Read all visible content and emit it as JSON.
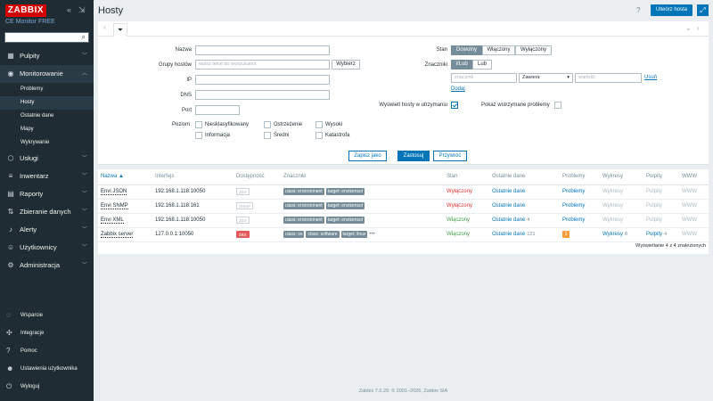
{
  "sidebar": {
    "logo": "ZABBIX",
    "edition": "CE Monitor FREE",
    "search_placeholder": "",
    "menu": [
      {
        "label": "Pulpity",
        "icon": "dashboard-icon"
      },
      {
        "label": "Monitorowanie",
        "icon": "eye-icon",
        "open": true,
        "children": [
          "Problemy",
          "Hosty",
          "Ostatnie dane",
          "Mapy",
          "Wykrywanie"
        ]
      },
      {
        "label": "Usługi",
        "icon": "services-icon"
      },
      {
        "label": "Inwentarz",
        "icon": "inventory-icon"
      },
      {
        "label": "Raporty",
        "icon": "reports-icon"
      },
      {
        "label": "Zbieranie danych",
        "icon": "data-collection-icon"
      },
      {
        "label": "Alerty",
        "icon": "bell-icon"
      },
      {
        "label": "Użytkownicy",
        "icon": "users-icon"
      },
      {
        "label": "Administracja",
        "icon": "gear-icon"
      }
    ],
    "bottom": [
      {
        "label": "Wsparcie",
        "icon": "support-icon"
      },
      {
        "label": "Integracje",
        "icon": "integrations-icon"
      },
      {
        "label": "Pomoc",
        "icon": "help-icon"
      },
      {
        "label": "Ustawienia użytkownika",
        "icon": "user-settings-icon"
      },
      {
        "label": "Wyloguj",
        "icon": "power-icon"
      }
    ]
  },
  "header": {
    "title": "Hosty",
    "help": "?",
    "create_host": "Utwórz hosta"
  },
  "filter": {
    "name_label": "Nazwa",
    "groups_label": "Grupy hostów",
    "groups_placeholder": "wpisz tekst do wyszukania",
    "select_button": "Wybierz",
    "ip_label": "IP",
    "dns_label": "DNS",
    "port_label": "Port",
    "severity_label": "Poziom",
    "severities": [
      "Niesklasyfikowany",
      "Informacja",
      "Ostrzeżenie",
      "Średni",
      "Wysoki",
      "Katastrofa"
    ],
    "status_label": "Stan",
    "status_options": [
      "Dowolny",
      "Włączony",
      "Wyłączony"
    ],
    "tags_label": "Znaczniki",
    "tag_mode_options": [
      "I/Lub",
      "Lub"
    ],
    "tag_placeholder": "znacznik",
    "tag_operator": "Zawiera",
    "tag_value_placeholder": "wartość",
    "remove_link": "Usuń",
    "add_link": "Dodaj",
    "show_maintenance_label": "Wyświetl hosty w utrzymaniu",
    "show_suppressed_label": "Pokaż wstrzymane problemy",
    "save_as": "Zapisz jako",
    "apply": "Zastosuj",
    "reset": "Przywróć"
  },
  "table": {
    "headers": [
      "Nazwa ▲",
      "Interfejs",
      "Dostępność",
      "Znaczniki",
      "Stan",
      "Ostatnie dane",
      "Problemy",
      "Wykresy",
      "Pulpity",
      "WWW"
    ],
    "rows": [
      {
        "name": "Envi JSON",
        "iface": "192.168.1.118:10050",
        "avail": "ZBX",
        "avail_red": false,
        "tags": [
          "class: environment",
          "target: envisensor"
        ],
        "more": "",
        "status": "Wyłączony",
        "status_class": "st-red",
        "latest": "Ostatnie dane",
        "latest_count": "",
        "problems": "Problemy",
        "problem_badge": "",
        "graphs": "Wykresy",
        "graphs_count": "",
        "graphs_link": false,
        "dash": "Pulpity",
        "dash_count": "",
        "dash_link": false,
        "web": "WWW"
      },
      {
        "name": "Envi SNMP",
        "iface": "192.168.1.118:161",
        "avail": "SNMP",
        "avail_red": false,
        "tags": [
          "class: environment",
          "target: envisensor"
        ],
        "more": "",
        "status": "Wyłączony",
        "status_class": "st-red",
        "latest": "Ostatnie dane",
        "latest_count": "",
        "problems": "Problemy",
        "problem_badge": "",
        "graphs": "Wykresy",
        "graphs_count": "",
        "graphs_link": false,
        "dash": "Pulpity",
        "dash_count": "",
        "dash_link": false,
        "web": "WWW"
      },
      {
        "name": "Envi XML",
        "iface": "192.168.1.118:10050",
        "avail": "ZBX",
        "avail_red": false,
        "tags": [
          "class: environment",
          "target: envisensor"
        ],
        "more": "",
        "status": "Włączony",
        "status_class": "st-green",
        "latest": "Ostatnie dane",
        "latest_count": "4",
        "problems": "Problemy",
        "problem_badge": "",
        "graphs": "Wykresy",
        "graphs_count": "",
        "graphs_link": false,
        "dash": "Pulpity",
        "dash_count": "",
        "dash_link": false,
        "web": "WWW"
      },
      {
        "name": "Zabbix server",
        "iface": "127.0.0.1:10050",
        "avail": "ZBX",
        "avail_red": true,
        "tags": [
          "class: os",
          "class: software",
          "target: linux"
        ],
        "more": "•••",
        "status": "Włączony",
        "status_class": "st-green",
        "latest": "Ostatnie dane",
        "latest_count": "121",
        "problems": "",
        "problem_badge": "1",
        "graphs": "Wykresy",
        "graphs_count": "8",
        "graphs_link": true,
        "dash": "Pulpity",
        "dash_count": "4",
        "dash_link": true,
        "web": "WWW"
      }
    ]
  },
  "paging": "Wyświetlanie 4 z 4 znalezionych",
  "footer": "Zabbix 7.0.29. © 2001–2026, Zabbix SIA"
}
